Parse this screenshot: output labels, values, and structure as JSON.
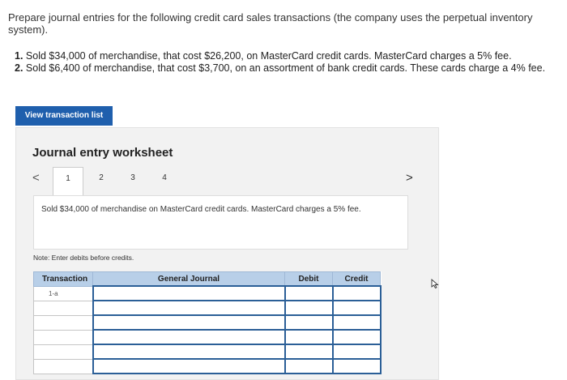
{
  "question": "Prepare journal entries for the following credit card sales transactions (the company uses the perpetual inventory system).",
  "items": [
    {
      "num": "1.",
      "text": "Sold $34,000 of merchandise, that cost $26,200, on MasterCard credit cards. MasterCard charges a 5% fee."
    },
    {
      "num": "2.",
      "text": "Sold $6,400 of merchandise, that cost $3,700, on an assortment of bank credit cards. These cards charge a 4% fee."
    }
  ],
  "view_button": "View transaction list",
  "worksheet": {
    "title": "Journal entry worksheet",
    "nav_prev": "<",
    "nav_next": ">",
    "tabs": [
      "1",
      "2",
      "3",
      "4"
    ],
    "active_tab": "1",
    "description": "Sold $34,000 of merchandise on MasterCard credit cards. MasterCard charges a 5% fee.",
    "note": "Note: Enter debits before credits.",
    "table": {
      "headers": [
        "Transaction",
        "General Journal",
        "Debit",
        "Credit"
      ],
      "first_transaction": "1-a"
    }
  },
  "colors": {
    "button_bg": "#1f5fad",
    "header_bg": "#b8cfe8",
    "input_border": "#2b5f97"
  }
}
